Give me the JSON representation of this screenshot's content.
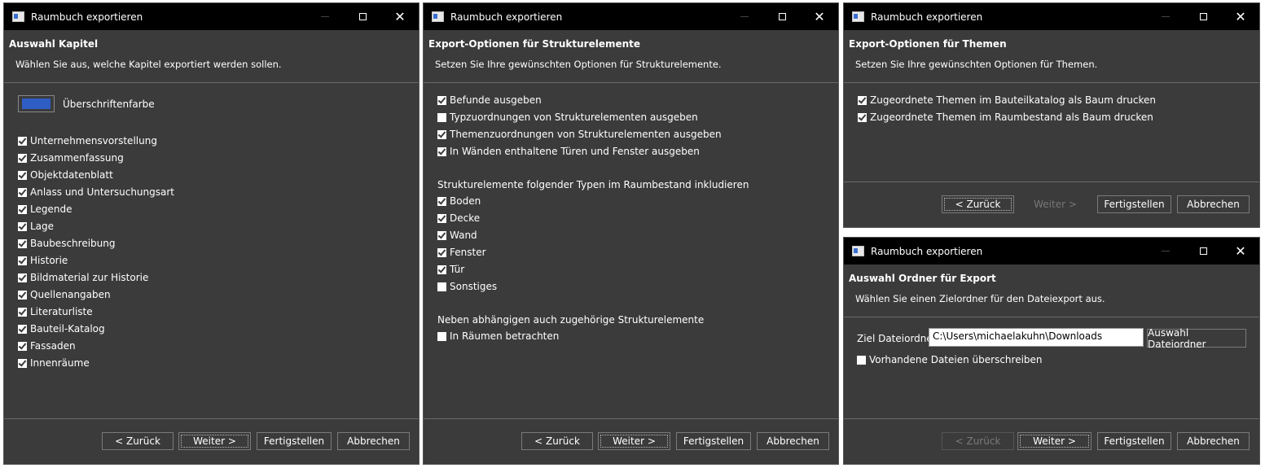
{
  "window_title": "Raumbuch exportieren",
  "common_buttons": {
    "back": "< Zurück",
    "next": "Weiter >",
    "finish": "Fertigstellen",
    "cancel": "Abbrechen"
  },
  "win1": {
    "header_title": "Auswahl Kapitel",
    "header_sub": "Wählen Sie aus, welche Kapitel exportiert werden sollen.",
    "color_label": "Überschriftenfarbe",
    "chapters": [
      {
        "label": "Unternehmensvorstellung",
        "checked": true
      },
      {
        "label": "Zusammenfassung",
        "checked": true
      },
      {
        "label": "Objektdatenblatt",
        "checked": true
      },
      {
        "label": "Anlass und Untersuchungsart",
        "checked": true
      },
      {
        "label": "Legende",
        "checked": true
      },
      {
        "label": "Lage",
        "checked": true
      },
      {
        "label": "Baubeschreibung",
        "checked": true
      },
      {
        "label": "Historie",
        "checked": true
      },
      {
        "label": "Bildmaterial zur Historie",
        "checked": true
      },
      {
        "label": "Quellenangaben",
        "checked": true
      },
      {
        "label": "Literaturliste",
        "checked": true
      },
      {
        "label": "Bauteil-Katalog",
        "checked": true
      },
      {
        "label": "Fassaden",
        "checked": true
      },
      {
        "label": "Innenräume",
        "checked": true
      }
    ]
  },
  "win2": {
    "header_title": "Export-Optionen für Strukturelemente",
    "header_sub": "Setzen Sie Ihre gewünschten Optionen für Strukturelemente.",
    "options": [
      {
        "label": "Befunde ausgeben",
        "checked": true
      },
      {
        "label": "Typzuordnungen von Strukturelementen ausgeben",
        "checked": false
      },
      {
        "label": "Themenzuordnungen von Strukturelementen ausgeben",
        "checked": true
      },
      {
        "label": "In Wänden enthaltene Türen und Fenster ausgeben",
        "checked": true
      }
    ],
    "types_heading": "Strukturelemente folgender Typen im Raumbestand inkludieren",
    "types": [
      {
        "label": "Boden",
        "checked": true
      },
      {
        "label": "Decke",
        "checked": true
      },
      {
        "label": "Wand",
        "checked": true
      },
      {
        "label": "Fenster",
        "checked": true
      },
      {
        "label": "Tür",
        "checked": true
      },
      {
        "label": "Sonstiges",
        "checked": false
      }
    ],
    "related_heading": "Neben abhängigen auch zugehörige Strukturelemente",
    "related": [
      {
        "label": "In Räumen betrachten",
        "checked": false
      }
    ]
  },
  "win3": {
    "header_title": "Export-Optionen für Themen",
    "header_sub": "Setzen Sie Ihre gewünschten Optionen für Themen.",
    "options": [
      {
        "label": "Zugeordnete Themen im Bauteilkatalog als Baum drucken",
        "checked": true
      },
      {
        "label": "Zugeordnete Themen im Raumbestand als Baum drucken",
        "checked": true
      }
    ]
  },
  "win4": {
    "header_title": "Auswahl Ordner für Export",
    "header_sub": "Wählen Sie einen Zielordner für den Dateiexport aus.",
    "folder_label": "Ziel Dateiordner",
    "folder_value": "C:\\Users\\michaelakuhn\\Downloads",
    "browse_button": "Auswahl Dateiordner",
    "overwrite_label": "Vorhandene Dateien überschreiben",
    "overwrite_checked": false
  }
}
